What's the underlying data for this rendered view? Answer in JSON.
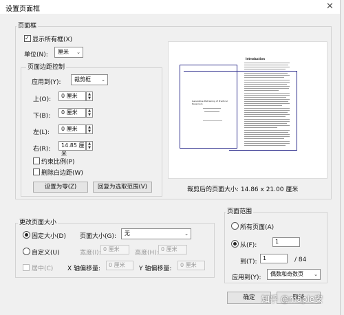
{
  "dialog": {
    "title": "设置页面框",
    "close_glyph": "✕"
  },
  "page_box": {
    "group_label": "页面框",
    "show_all_label": "显示所有框(X)",
    "units_label": "单位(N):",
    "units_value": "厘米",
    "margins": {
      "group_label": "页面边距控制",
      "apply_to_label": "应用到(Y):",
      "apply_to_value": "裁剪框",
      "top_label": "上(O):",
      "top_value": "0 厘米",
      "bottom_label": "下(B):",
      "bottom_value": "0 厘米",
      "left_label": "左(L):",
      "left_value": "0 厘米",
      "right_label": "右(R):",
      "right_value": "14.85 厘米",
      "constrain_label": "约束比例(P)",
      "remove_white_label": "删除白边距(W)",
      "set_zero_button": "设置为零(Z)",
      "revert_button": "回复为选取范围(V)"
    },
    "preview_caption": "裁剪后的页面大小: 14.86 x 21.00 厘米"
  },
  "change_size": {
    "group_label": "更改页面大小",
    "fixed_label": "固定大小(D)",
    "page_size_label": "页面大小(G):",
    "page_size_value": "无",
    "custom_label": "自定义(U)",
    "width_label": "宽度(I):",
    "width_value": "0 厘米",
    "height_label": "高度(H):",
    "height_value": "0 厘米",
    "center_label": "居中(C)",
    "x_offset_label": "X 轴偏移量:",
    "x_offset_value": "0 厘米",
    "y_offset_label": "Y 轴偏移量:",
    "y_offset_value": "0 厘米"
  },
  "page_range": {
    "group_label": "页面范围",
    "all_pages_label": "所有页面(A)",
    "from_label": "从(F):",
    "from_value": "1",
    "to_label": "到(T):",
    "to_value": "1",
    "total_pages": "/ 84",
    "apply_to_label": "应用到(Y):",
    "apply_to_value": "偶数和奇数页"
  },
  "footer": {
    "ok_button": "确定",
    "cancel_button": "取消",
    "watermark": "知乎 @maple安"
  },
  "preview_doc": {
    "heading": "Introduction",
    "left_title": "Generative Pretraining of Practical Reasoners"
  }
}
